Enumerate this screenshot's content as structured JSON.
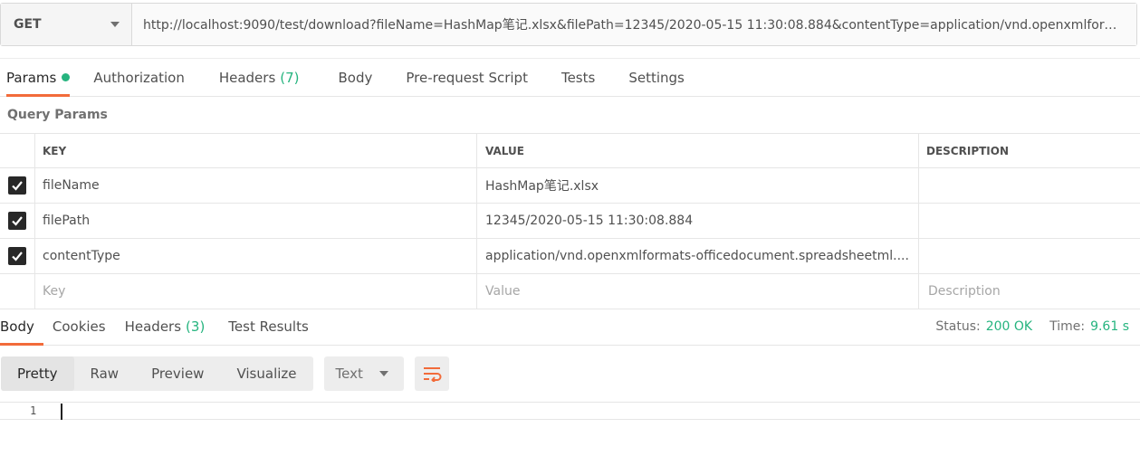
{
  "request": {
    "method": "GET",
    "url": "http://localhost:9090/test/download?fileName=HashMap笔记.xlsx&filePath=12345/2020-05-15 11:30:08.884&contentType=application/vnd.openxmlforma..."
  },
  "request_tabs": [
    {
      "label": "Params",
      "active": true,
      "dot": true
    },
    {
      "label": "Authorization"
    },
    {
      "label": "Headers",
      "count": "(7)"
    },
    {
      "label": "Body"
    },
    {
      "label": "Pre-request Script"
    },
    {
      "label": "Tests"
    },
    {
      "label": "Settings"
    }
  ],
  "query_params": {
    "title": "Query Params",
    "columns": [
      "KEY",
      "VALUE",
      "DESCRIPTION"
    ],
    "rows": [
      {
        "checked": true,
        "key": "fileName",
        "value": "HashMap笔记.xlsx",
        "description": ""
      },
      {
        "checked": true,
        "key": "filePath",
        "value": "12345/2020-05-15 11:30:08.884",
        "description": ""
      },
      {
        "checked": true,
        "key": "contentType",
        "value": "application/vnd.openxmlformats-officedocument.spreadsheetml....",
        "description": ""
      }
    ],
    "placeholders": {
      "key": "Key",
      "value": "Value",
      "description": "Description"
    }
  },
  "response_tabs": [
    {
      "label": "Body",
      "active": true
    },
    {
      "label": "Cookies"
    },
    {
      "label": "Headers",
      "count": "(3)"
    },
    {
      "label": "Test Results"
    }
  ],
  "response_status": {
    "status_label": "Status:",
    "status_value": "200 OK",
    "time_label": "Time:",
    "time_value": "9.61 s"
  },
  "body_toolbar": {
    "modes": [
      "Pretty",
      "Raw",
      "Preview",
      "Visualize"
    ],
    "active_mode": "Pretty",
    "format": "Text"
  },
  "editor": {
    "line_numbers": [
      "1"
    ]
  },
  "icons": {
    "method_dropdown": "chevron-down-icon",
    "format_dropdown": "chevron-down-icon",
    "wrap": "wrap-lines-icon",
    "checkbox": "check-icon"
  },
  "colors": {
    "accent": "#f26b3a",
    "success": "#26b47f",
    "checkbox": "#282828"
  }
}
